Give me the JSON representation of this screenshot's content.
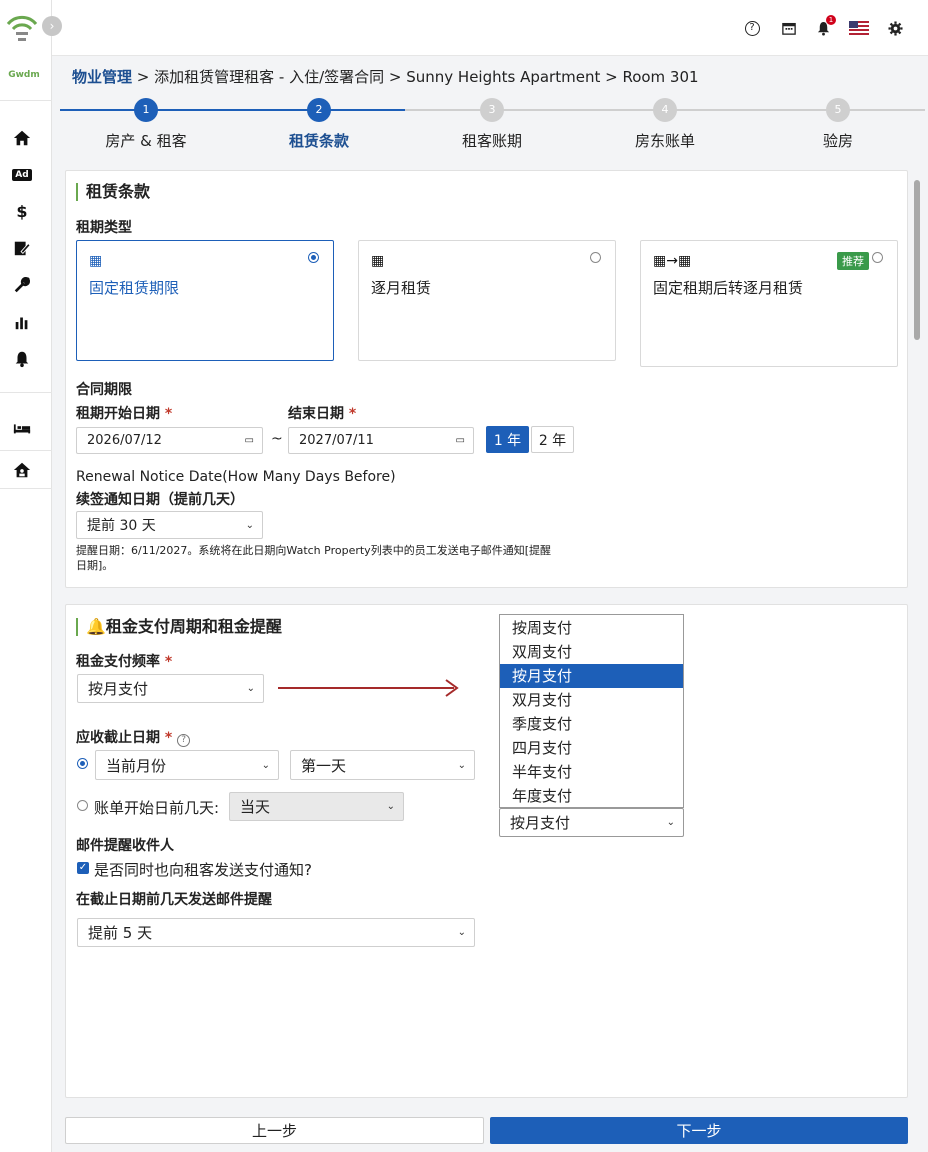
{
  "sidebar": {
    "brand_mini": "Gwdm",
    "items": [
      {
        "icon": "home-icon"
      },
      {
        "icon": "ad-icon",
        "glyph": "Ad"
      },
      {
        "icon": "dollar-icon",
        "glyph": "$"
      },
      {
        "icon": "edit-icon"
      },
      {
        "icon": "wrench-icon"
      },
      {
        "icon": "bar-chart-icon"
      },
      {
        "icon": "bell-icon"
      },
      {
        "icon": "bed-icon"
      },
      {
        "icon": "house-user-icon"
      }
    ]
  },
  "topbar": {
    "notification_count": "1",
    "help_glyph": "?"
  },
  "breadcrumb": {
    "root": "物业管理",
    "rest": " > 添加租赁管理租客 - 入住/签署合同 > Sunny Heights Apartment > Room 301"
  },
  "steps": [
    {
      "num": "1",
      "label": "房产 & 租客"
    },
    {
      "num": "2",
      "label": "租赁条款"
    },
    {
      "num": "3",
      "label": "租客账期"
    },
    {
      "num": "4",
      "label": "房东账单"
    },
    {
      "num": "5",
      "label": "验房"
    }
  ],
  "lease": {
    "title": "租赁条款",
    "type_label": "租期类型",
    "types": [
      {
        "label": "固定租赁期限",
        "selected": true
      },
      {
        "label": "逐月租赁",
        "selected": false
      },
      {
        "label": "固定租期后转逐月租赁",
        "selected": false,
        "badge": "推荐"
      }
    ],
    "period_label": "合同期限",
    "start_label": "租期开始日期",
    "end_label": "结束日期",
    "required_mark": "*",
    "start_date": "2026/07/12",
    "end_date": "2027/07/11",
    "tilde": "~",
    "year_buttons": [
      "1 年",
      "2 年"
    ],
    "renewal_en": "Renewal Notice Date(How Many Days Before)",
    "renewal_cn": "续签通知日期（提前几天）",
    "renewal_value": "提前 30 天",
    "hint": "提醒日期：6/11/2027。系统将在此日期向Watch Property列表中的员工发送电子邮件通知[提醒日期]。"
  },
  "rent": {
    "title": "租金支付周期和租金提醒",
    "freq_label": "租金支付频率",
    "freq_value": "按月支付",
    "due_label": "应收截止日期",
    "due_month": "当前月份",
    "due_day": "第一天",
    "before_label": "账单开始日前几天:",
    "before_value": "当天",
    "email_label": "邮件提醒收件人",
    "notify_label": "是否同时也向租客发送支付通知?",
    "days_label": "在截止日期前几天发送邮件提醒",
    "days_value": "提前 5 天",
    "dropdown_options": [
      "按周支付",
      "双周支付",
      "按月支付",
      "双月支付",
      "季度支付",
      "四月支付",
      "半年支付",
      "年度支付"
    ],
    "dropdown_selected": "按月支付",
    "dropdown_highlight_index": 2
  },
  "footer": {
    "prev": "上一步",
    "next": "下一步"
  },
  "colors": {
    "primary": "#1d5fb8",
    "accent_green": "#6aa84f",
    "arrow": "#a52a2a"
  }
}
